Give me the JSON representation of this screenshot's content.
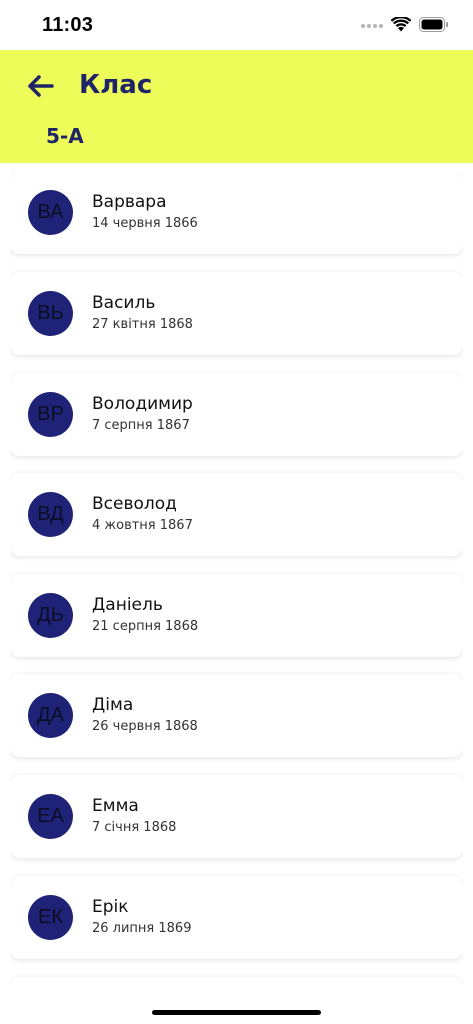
{
  "status_bar": {
    "time": "11:03"
  },
  "header": {
    "title": "Клас",
    "subtitle": "5-А"
  },
  "students": [
    {
      "initials": "ВА",
      "name": "Варвара",
      "date": "14 червня 1866"
    },
    {
      "initials": "ВЬ",
      "name": "Василь",
      "date": "27 квітня 1868"
    },
    {
      "initials": "ВР",
      "name": "Володимир",
      "date": "7 серпня 1867"
    },
    {
      "initials": "ВД",
      "name": "Всеволод",
      "date": "4 жовтня 1867"
    },
    {
      "initials": "ДЬ",
      "name": "Даніель",
      "date": "21 серпня 1868"
    },
    {
      "initials": "ДА",
      "name": "Діма",
      "date": "26 червня 1868"
    },
    {
      "initials": "ЕА",
      "name": "Емма",
      "date": "7 січня 1868"
    },
    {
      "initials": "ЕК",
      "name": "Ерік",
      "date": "26 липня 1869"
    }
  ],
  "colors": {
    "header_bg": "#eefc5a",
    "accent": "#1f2468",
    "avatar_bg": "#1f2377"
  }
}
